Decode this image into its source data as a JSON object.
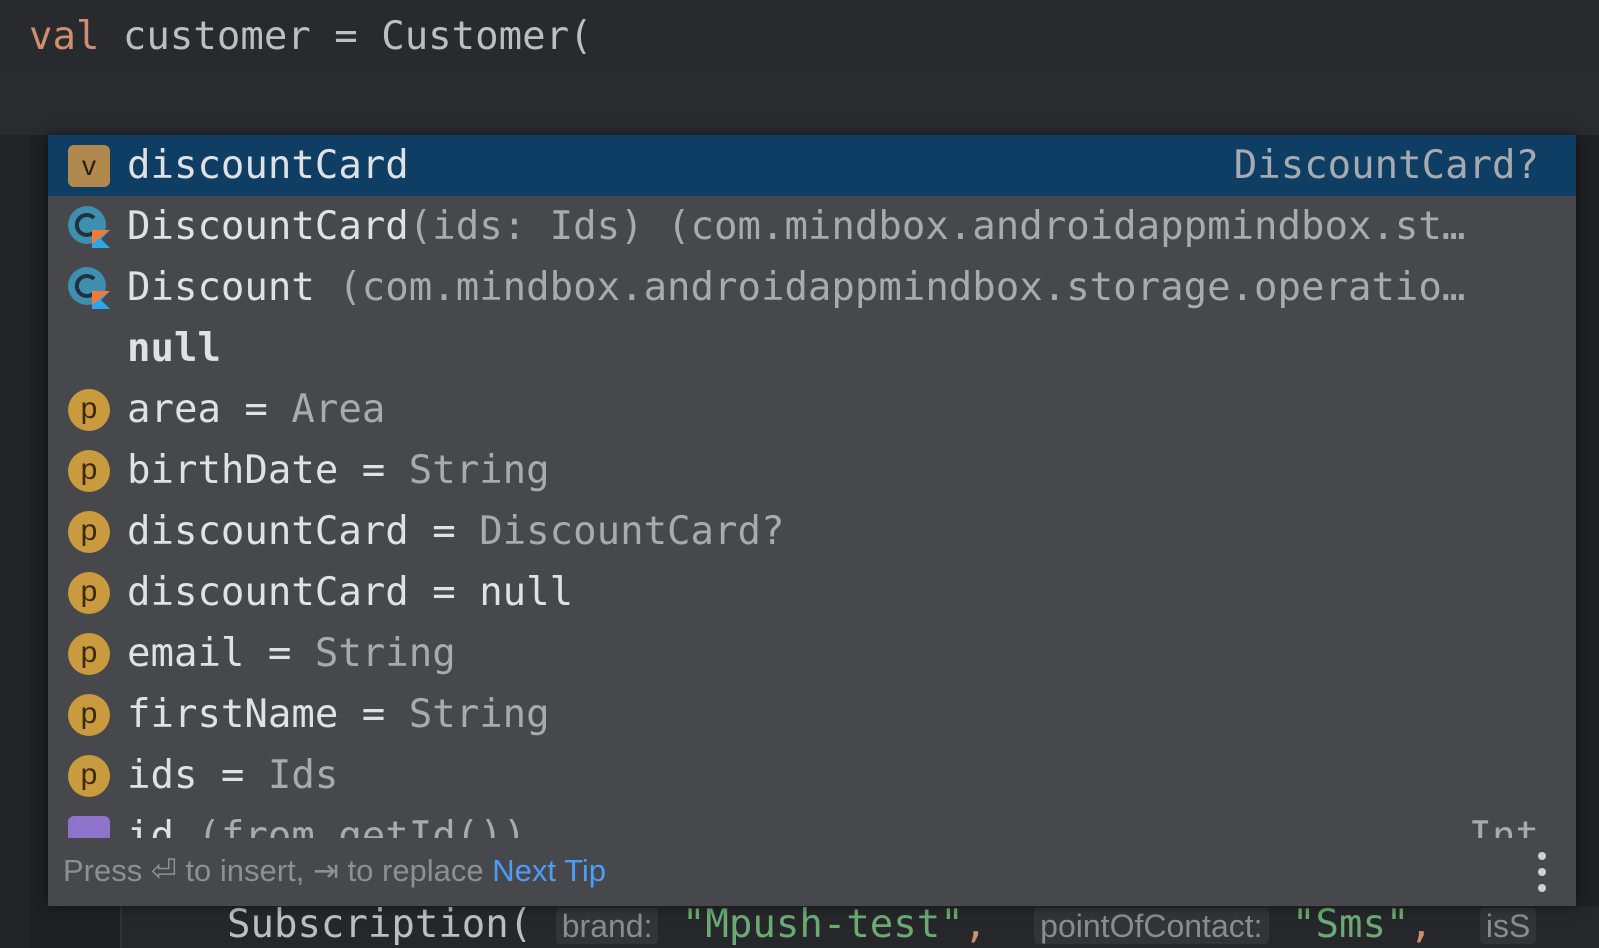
{
  "editor": {
    "top_line": {
      "keyword": "val",
      "rest": " customer = Customer("
    },
    "bottom_line": {
      "call": "Subscription(",
      "hint_brand": "brand:",
      "brand_value": "\"Mpush-test\"",
      "comma1": ",",
      "hint_poc": "pointOfContact:",
      "poc_value": "\"Sms\"",
      "comma2": ",",
      "hint_next": "isS"
    }
  },
  "completion": {
    "items": [
      {
        "icon": "variable-icon",
        "icon_letter": "v",
        "name": "discountCard",
        "tail": "",
        "type": "DiscountCard?",
        "selected": true
      },
      {
        "icon": "kotlin-class-icon",
        "name": "DiscountCard",
        "tail": "(ids: Ids) (com.mindbox.androidappmindbox.st…",
        "type": ""
      },
      {
        "icon": "kotlin-class-icon",
        "name": "Discount",
        "tail": " (com.mindbox.androidappmindbox.storage.operatio…",
        "type": ""
      },
      {
        "icon": "",
        "name": "null",
        "tail": "",
        "type": "",
        "bold": true
      },
      {
        "icon": "parameter-icon",
        "icon_letter": "p",
        "name": "area = ",
        "tail": "Area",
        "type": ""
      },
      {
        "icon": "parameter-icon",
        "icon_letter": "p",
        "name": "birthDate = ",
        "tail": "String",
        "type": ""
      },
      {
        "icon": "parameter-icon",
        "icon_letter": "p",
        "name": "discountCard = ",
        "tail": "DiscountCard?",
        "type": ""
      },
      {
        "icon": "parameter-icon",
        "icon_letter": "p",
        "name": "discountCard = null",
        "tail": "",
        "type": ""
      },
      {
        "icon": "parameter-icon",
        "icon_letter": "p",
        "name": "email = ",
        "tail": "String",
        "type": ""
      },
      {
        "icon": "parameter-icon",
        "icon_letter": "p",
        "name": "firstName = ",
        "tail": "String",
        "type": ""
      },
      {
        "icon": "parameter-icon",
        "icon_letter": "p",
        "name": "ids = ",
        "tail": "Ids",
        "type": ""
      },
      {
        "icon": "method-icon",
        "name": "id",
        "tail": " (from getId())",
        "type": "Int"
      }
    ],
    "footer": {
      "press": "Press ⏎ to insert, ⇥ to replace ",
      "next_tip": "Next Tip"
    }
  },
  "colors": {
    "selection": "#0e3e63",
    "popup_bg": "#46484c",
    "keyword": "#cf8e6d",
    "string": "#6aab73",
    "link": "#4d9cf8"
  }
}
